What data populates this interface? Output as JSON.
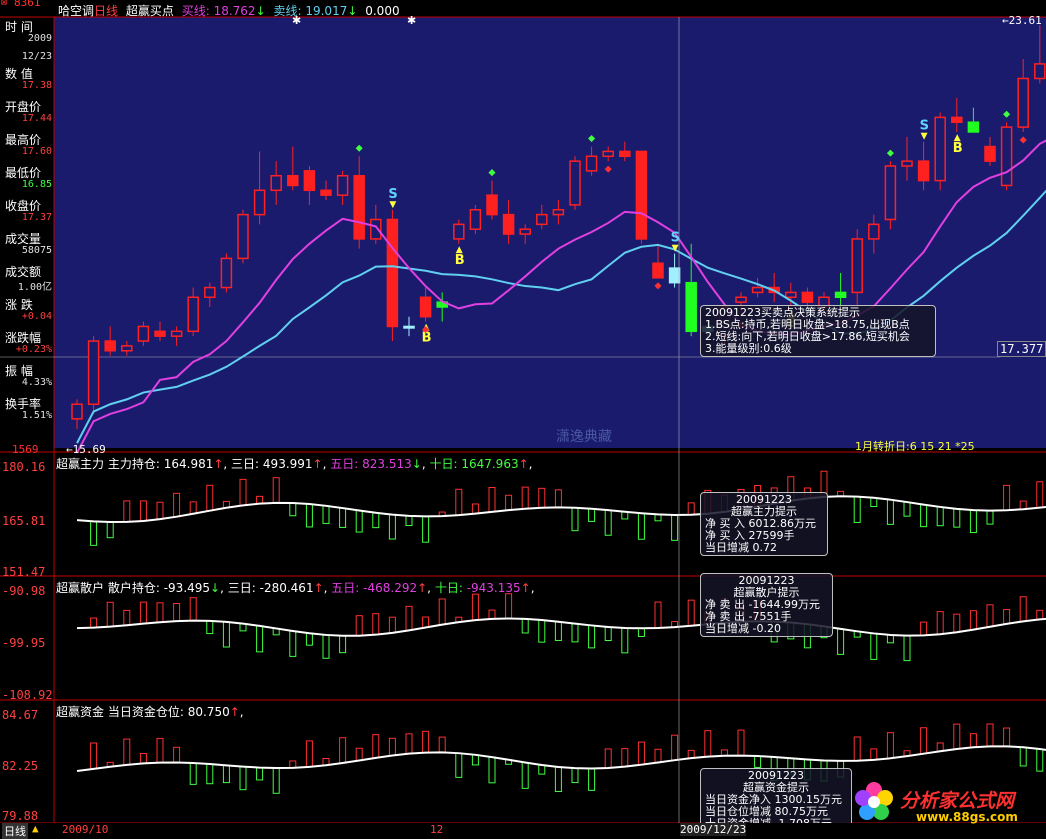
{
  "title_bar": {
    "name": "哈空调",
    "period": "日线",
    "indicator": "超赢买点",
    "buy_line_label": "买线:",
    "buy_line_value": "18.762",
    "buy_arrow": "↓",
    "sell_line_label": "卖线:",
    "sell_line_value": "19.017",
    "sell_arrow": "↓",
    "extra_value": "0.000"
  },
  "left_panel": [
    {
      "label": "时  间",
      "value": "2009",
      "color": "#e0e0e0"
    },
    {
      "label": "",
      "value": "12/23",
      "color": "#e0e0e0"
    },
    {
      "label": "数  值",
      "value": "17.38",
      "color": "#ff4040"
    },
    {
      "label": "开盘价",
      "value": "17.44",
      "color": "#ff4040"
    },
    {
      "label": "最高价",
      "value": "17.60",
      "color": "#ff4040"
    },
    {
      "label": "最低价",
      "value": "16.85",
      "color": "#40ff40"
    },
    {
      "label": "收盘价",
      "value": "17.37",
      "color": "#ff4040"
    },
    {
      "label": "成交量",
      "value": "58075",
      "color": "#e0e0e0"
    },
    {
      "label": "成交额",
      "value": "1.00亿",
      "color": "#e0e0e0"
    },
    {
      "label": "涨  跌",
      "value": "+0.04",
      "color": "#ff4040"
    },
    {
      "label": "涨跌幅",
      "value": "+0.23%",
      "color": "#ff4040"
    },
    {
      "label": "振  幅",
      "value": "4.33%",
      "color": "#e0e0e0"
    },
    {
      "label": "换手率",
      "value": "1.51%",
      "color": "#e0e0e0"
    }
  ],
  "price_chart": {
    "top_corner_value": "8361",
    "high_label": "23.61",
    "low_label": "15.69",
    "bottom_axis_label": "1569",
    "current_price_tag": "17.377",
    "watermark": "潇逸典藏",
    "turn_dates": "1月转折日:6  15  21  *25",
    "signal_buy": "B",
    "signal_sell": "S"
  },
  "price_tooltip": {
    "lines": [
      "20091223买卖点决策系统提示",
      "1.BS点:持币,若明日收盘>18.75,出现B点",
      "2.短线:向下,若明日收盘>17.86,短买机会",
      "3.能量级别:0.6级"
    ]
  },
  "panel_main": {
    "name": "超赢主力",
    "label": "主力持仓:",
    "v1": "164.981",
    "a1": "↑",
    "l2": "三日:",
    "v2": "493.991",
    "a2": "↑",
    "l3": "五日:",
    "v3": "823.513",
    "a3": "↓",
    "l4": "十日:",
    "v4": "1647.963",
    "a4": "↑",
    "axis_top": "180.16",
    "axis_mid": "165.81",
    "axis_bot": "151.47",
    "tip": [
      "20091223",
      "超赢主力提示",
      "净 买 入 6012.86万元",
      "净 买 入 27599手",
      "当日增减 0.72"
    ]
  },
  "panel_retail": {
    "name": "超赢散户",
    "label": "散户持仓:",
    "v1": "-93.495",
    "a1": "↓",
    "l2": "三日:",
    "v2": "-280.461",
    "a2": "↑",
    "l3": "五日:",
    "v3": "-468.292",
    "a3": "↑",
    "l4": "十日:",
    "v4": "-943.135",
    "a4": "↑",
    "axis_top": "-90.98",
    "axis_mid": "-99.95",
    "axis_bot": "-108.92",
    "tip": [
      "20091223",
      "超赢散户提示",
      "净 卖 出 -1644.99万元",
      "净 卖 出 -7551手",
      "当日增减 -0.20"
    ]
  },
  "panel_fund": {
    "name": "超赢资金",
    "label": "当日资金仓位:",
    "v1": "80.750",
    "a1": "↑",
    "axis_top": "84.67",
    "axis_mid": "82.25",
    "axis_bot": "79.88",
    "tip": [
      "20091223",
      "超赢资金提示",
      "当日资金净入 1300.15万元",
      "当日仓位增减 80.75万元",
      "十日资金增减 -1.708万元"
    ]
  },
  "bottom_bar": {
    "period_tab": "日线",
    "date_start": "2009/10",
    "date_mid": "12",
    "date_cursor": "2009/12/23"
  },
  "logo": {
    "name": "分析家公式网",
    "url": "www.88gs.com"
  },
  "colors": {
    "price_bg": "#1b1b6e",
    "up": "#ff2020",
    "down_cyan": "#a0f0ff",
    "down_green": "#20ff20",
    "buy_line": "#e040e0",
    "sell_line": "#60d0f0",
    "border": "#c00000"
  }
}
